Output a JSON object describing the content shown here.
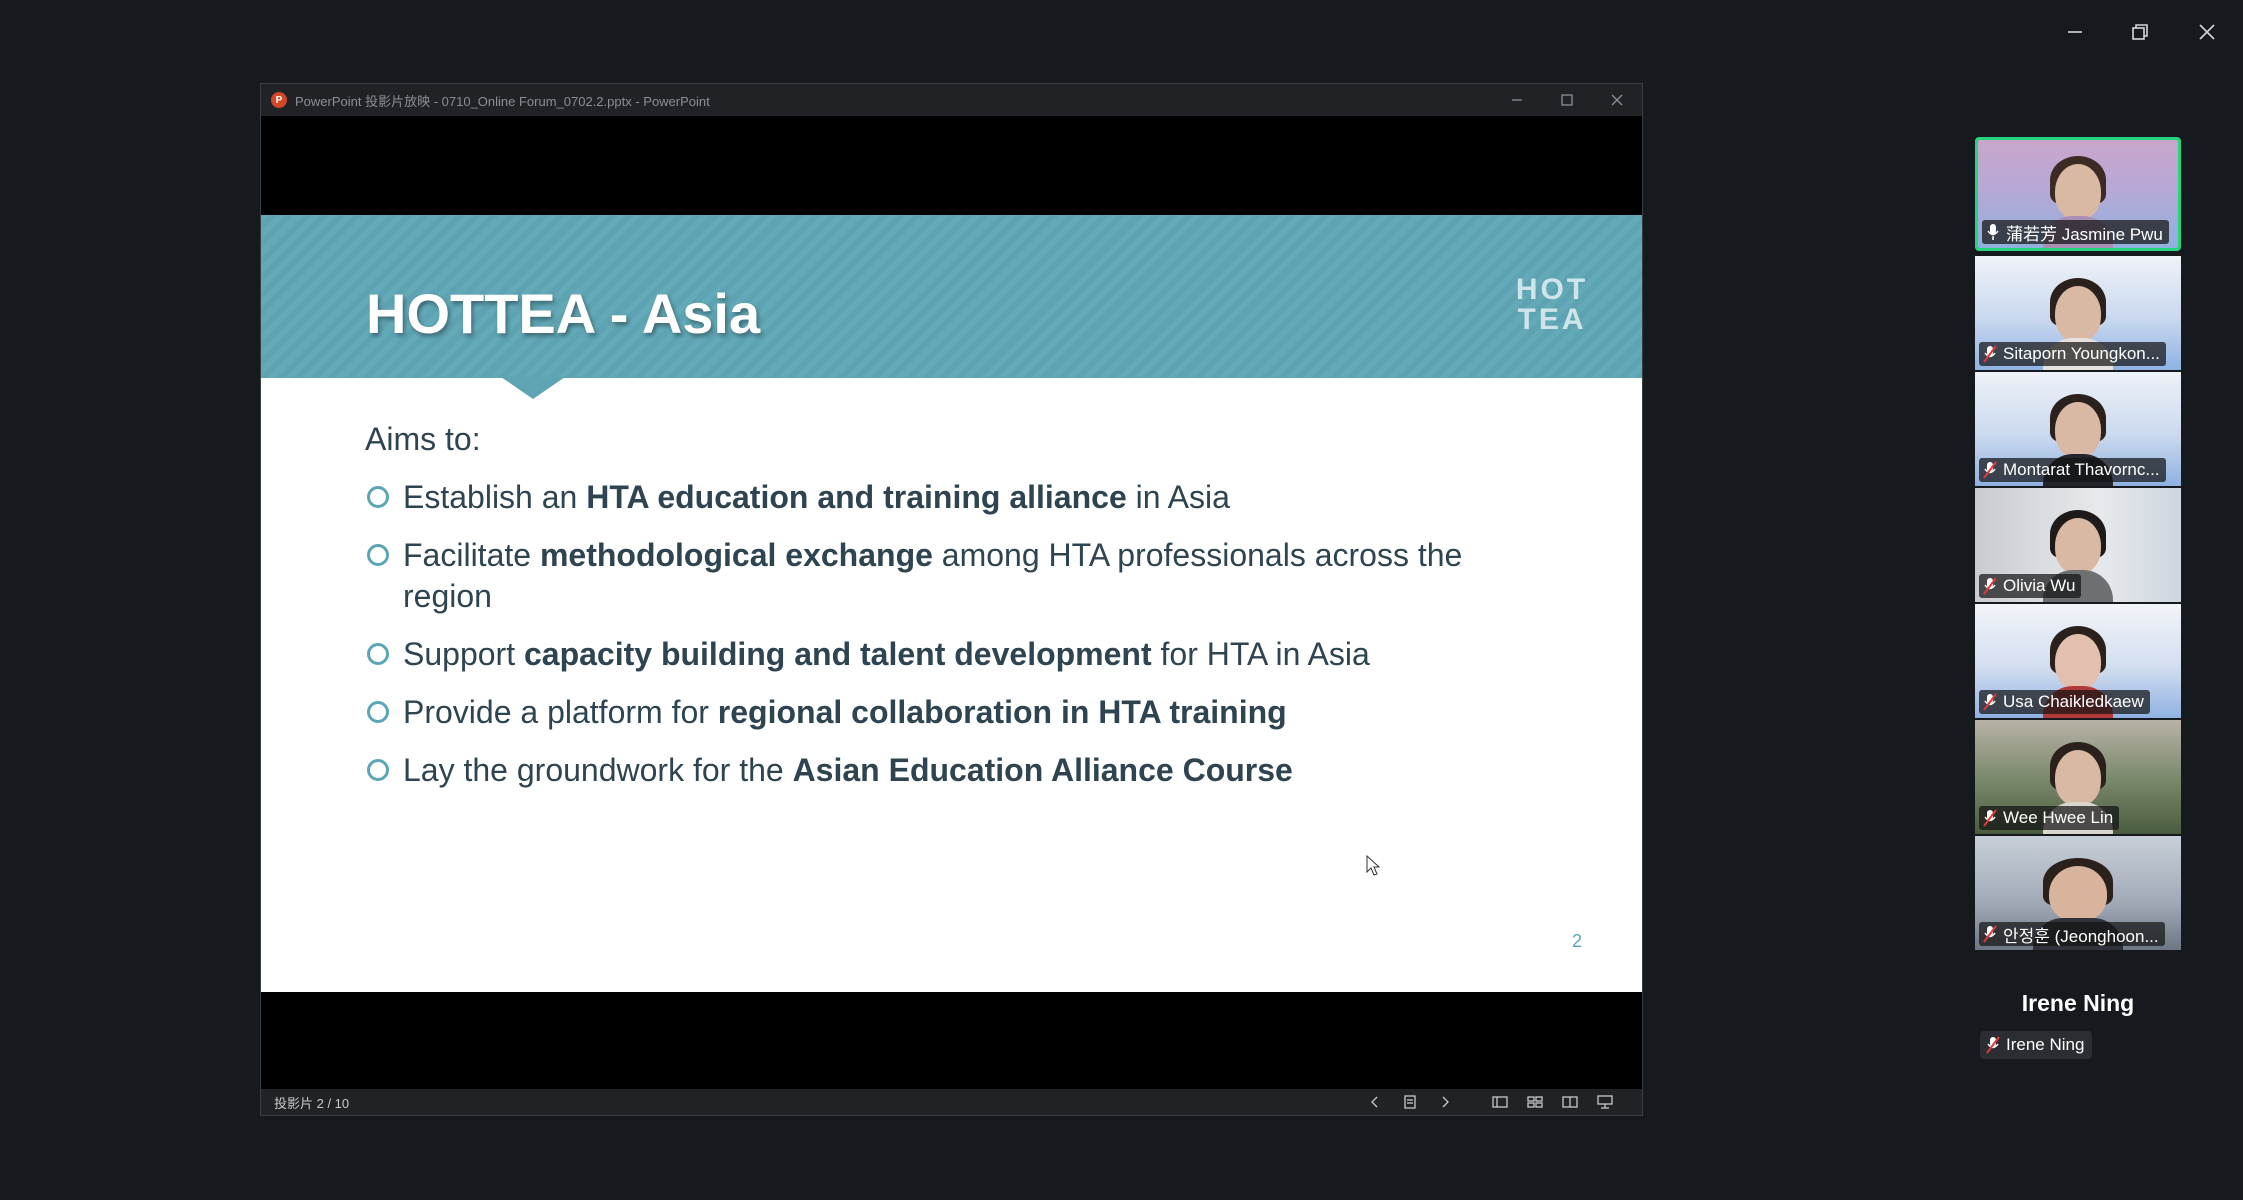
{
  "window": {
    "controls": [
      "minimize-icon",
      "restore-icon",
      "close-icon"
    ]
  },
  "ppt": {
    "title": "PowerPoint 投影片放映 - 0710_Online Forum_0702.2.pptx - PowerPoint",
    "logo_letter": "P",
    "status": "投影片 2 / 10"
  },
  "slide": {
    "title": "HOTTEA - Asia",
    "logo_line1": "HOT",
    "logo_line2": "TEA",
    "aims": "Aims to:",
    "page_number": "2",
    "bullets": [
      {
        "pre": "Establish an ",
        "bold": "HTA education and training alliance",
        "post": " in Asia"
      },
      {
        "pre": "Facilitate ",
        "bold": "methodological exchange",
        "post": " among HTA professionals across the region"
      },
      {
        "pre": "Support ",
        "bold": "capacity building and talent development",
        "post": " for HTA in Asia"
      },
      {
        "pre": "Provide a platform for ",
        "bold": "regional collaboration in HTA training",
        "post": ""
      },
      {
        "pre": "Lay the groundwork for the ",
        "bold": "Asian Education Alliance Course",
        "post": ""
      }
    ]
  },
  "participants": [
    {
      "name": "蒲若芳 Jasmine Pwu",
      "active": true,
      "muted": false
    },
    {
      "name": "Sitaporn Youngkon...",
      "active": false,
      "muted": true
    },
    {
      "name": "Montarat Thavornc...",
      "active": false,
      "muted": true
    },
    {
      "name": "Olivia Wu",
      "active": false,
      "muted": true
    },
    {
      "name": "Usa Chaikledkaew",
      "active": false,
      "muted": true
    },
    {
      "name": "Wee Hwee Lin",
      "active": false,
      "muted": true
    },
    {
      "name": "안정훈 (Jeonghoon...",
      "active": false,
      "muted": true
    }
  ],
  "self_view": {
    "big_name": "Irene Ning",
    "tag_name": "Irene Ning"
  }
}
